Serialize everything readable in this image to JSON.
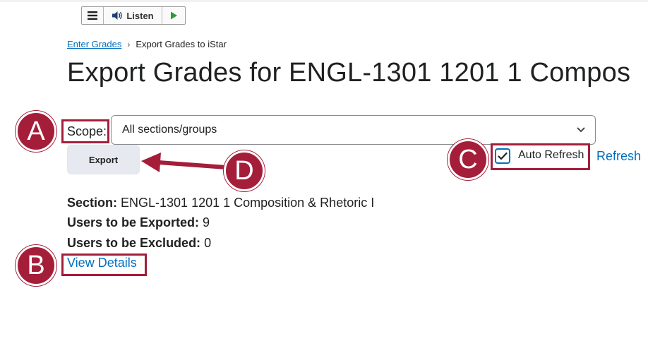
{
  "toolbar": {
    "listen_label": "Listen",
    "menu_icon": "menu-icon",
    "speaker_icon": "speaker-icon",
    "play_icon": "play-icon"
  },
  "breadcrumb": {
    "link": "Enter Grades",
    "separator": "›",
    "current": "Export Grades to iStar"
  },
  "page": {
    "title": "Export Grades for ENGL-1301 1201 1 Compos"
  },
  "scope": {
    "label": "Scope:",
    "selected": "All sections/groups"
  },
  "export": {
    "label": "Export"
  },
  "auto_refresh": {
    "label": "Auto Refresh",
    "checked": true,
    "refresh_label": "Refresh"
  },
  "info": {
    "section_label": "Section:",
    "section_value": " ENGL-1301 1201 1 Composition & Rhetoric I",
    "exported_label": "Users to be Exported:",
    "exported_value": " 9",
    "excluded_label": "Users to be Excluded:",
    "excluded_value": " 0",
    "details_label": "View Details"
  },
  "callouts": {
    "a": "A",
    "b": "B",
    "c": "C",
    "d": "D"
  },
  "colors": {
    "callout": "#a41e3a",
    "link": "#006fbf",
    "button_bg": "#e6eaf0"
  }
}
